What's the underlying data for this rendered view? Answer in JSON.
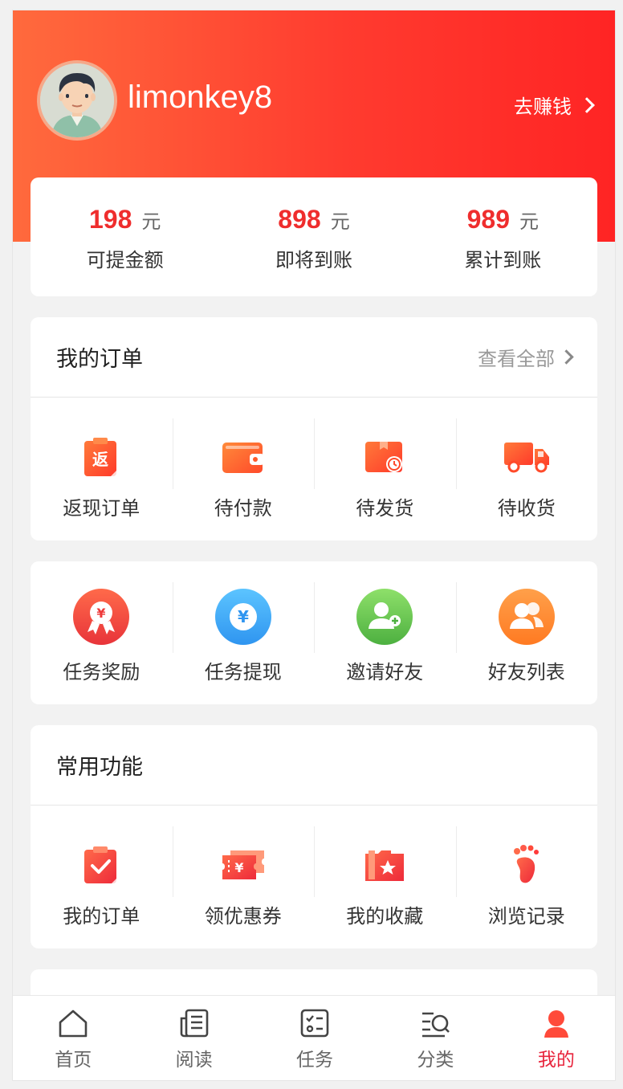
{
  "user": {
    "name": "limonkey8",
    "earn_link": "去赚钱"
  },
  "stats": [
    {
      "value": "198",
      "unit": "元",
      "label": "可提金额"
    },
    {
      "value": "898",
      "unit": "元",
      "label": "即将到账"
    },
    {
      "value": "989",
      "unit": "元",
      "label": "累计到账"
    }
  ],
  "orders": {
    "title": "我的订单",
    "view_all": "查看全部",
    "items": [
      {
        "label": "返现订单",
        "icon": "cashback-order-icon",
        "glyph": "返"
      },
      {
        "label": "待付款",
        "icon": "wallet-icon"
      },
      {
        "label": "待发货",
        "icon": "box-clock-icon"
      },
      {
        "label": "待收货",
        "icon": "truck-icon"
      }
    ]
  },
  "tasks": {
    "items": [
      {
        "label": "任务奖励",
        "icon": "reward-medal-icon",
        "glyph": "¥"
      },
      {
        "label": "任务提现",
        "icon": "withdraw-coin-icon",
        "glyph": "¥"
      },
      {
        "label": "邀请好友",
        "icon": "invite-friend-icon"
      },
      {
        "label": "好友列表",
        "icon": "friends-list-icon"
      }
    ]
  },
  "common": {
    "title": "常用功能",
    "items": [
      {
        "label": "我的订单",
        "icon": "clipboard-check-icon"
      },
      {
        "label": "领优惠券",
        "icon": "coupon-icon",
        "glyph": "¥"
      },
      {
        "label": "我的收藏",
        "icon": "favorite-folder-icon"
      },
      {
        "label": "浏览记录",
        "icon": "footprint-icon"
      }
    ]
  },
  "tabbar": [
    {
      "label": "首页",
      "icon": "home-icon"
    },
    {
      "label": "阅读",
      "icon": "news-icon"
    },
    {
      "label": "任务",
      "icon": "task-list-icon"
    },
    {
      "label": "分类",
      "icon": "category-search-icon"
    },
    {
      "label": "我的",
      "icon": "person-icon",
      "active": true
    }
  ],
  "colors": {
    "accent": "#ef2d2d",
    "header_start": "#ff6a3d",
    "header_end": "#ff2424",
    "tab_active": "#e8243c"
  }
}
